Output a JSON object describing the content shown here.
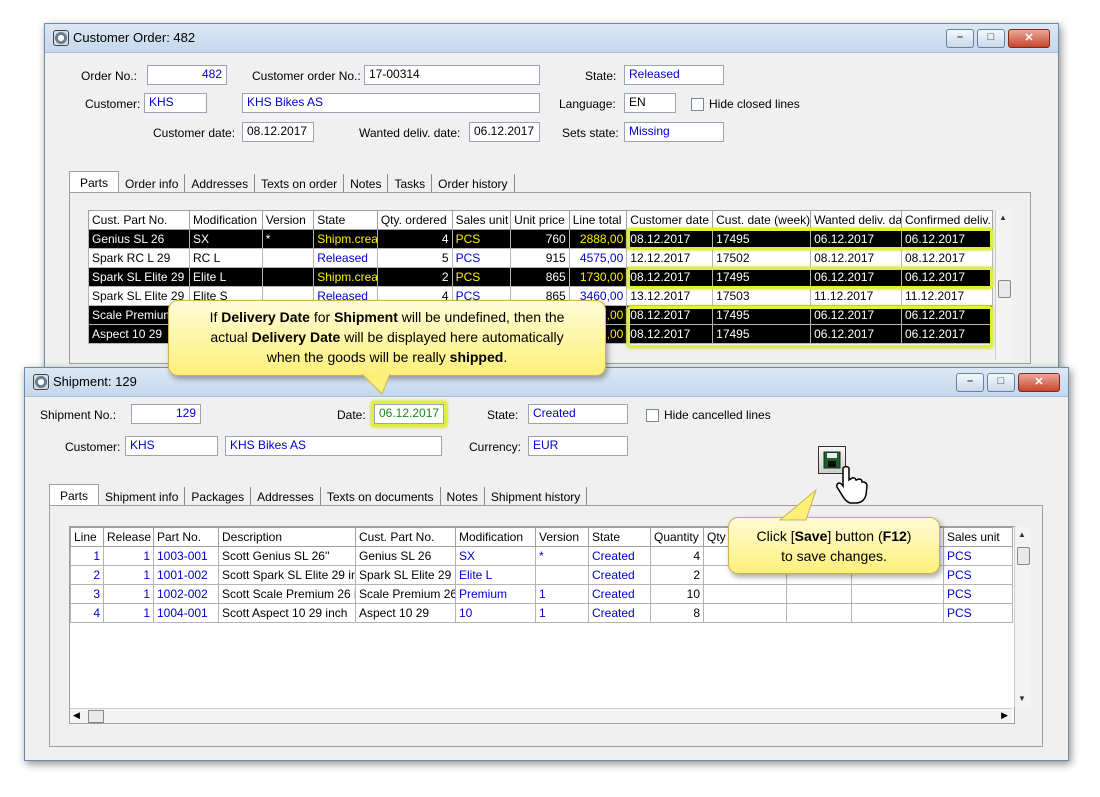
{
  "order_window": {
    "title": "Customer Order: 482",
    "order_no_label": "Order No.:",
    "order_no": "482",
    "customer_order_no_label": "Customer order No.:",
    "customer_order_no": "17-00314",
    "state_label": "State:",
    "state": "Released",
    "customer_label": "Customer:",
    "customer_code": "KHS",
    "customer_name": "KHS Bikes AS",
    "language_label": "Language:",
    "language": "EN",
    "hide_closed_label": "Hide closed lines",
    "customer_date_label": "Customer date:",
    "customer_date": "08.12.2017",
    "wanted_deliv_label": "Wanted deliv. date:",
    "wanted_deliv": "06.12.2017",
    "sets_state_label": "Sets state:",
    "sets_state": "Missing",
    "tabs": [
      "Parts",
      "Order info",
      "Addresses",
      "Texts on order",
      "Notes",
      "Tasks",
      "Order history"
    ],
    "columns": [
      "Cust. Part No.",
      "Modification",
      "Version",
      "State",
      "Qty. ordered",
      "Sales unit",
      "Unit price",
      "Line total",
      "Customer date",
      "Cust. date (week)",
      "Wanted deliv. da",
      "Confirmed deliv."
    ],
    "rows": [
      {
        "part": "Genius SL 26",
        "mod": "SX",
        "ver": "*",
        "state": "Shipm.creat",
        "qty": "4",
        "unit": "PCS",
        "price": "760",
        "total": "2888,00",
        "cdate": "08.12.2017",
        "cweek": "17495",
        "wanted": "06.12.2017",
        "confirmed": "06.12.2017"
      },
      {
        "part": "Spark RC L 29",
        "mod": "RC L",
        "ver": "",
        "state": "Released",
        "qty": "5",
        "unit": "PCS",
        "price": "915",
        "total": "4575,00",
        "cdate": "12.12.2017",
        "cweek": "17502",
        "wanted": "08.12.2017",
        "confirmed": "08.12.2017"
      },
      {
        "part": "Spark SL Elite 29",
        "mod": "Elite L",
        "ver": "",
        "state": "Shipm.creat",
        "qty": "2",
        "unit": "PCS",
        "price": "865",
        "total": "1730,00",
        "cdate": "08.12.2017",
        "cweek": "17495",
        "wanted": "06.12.2017",
        "confirmed": "06.12.2017"
      },
      {
        "part": "Spark SL Elite 29",
        "mod": "Elite S",
        "ver": "",
        "state": "Released",
        "qty": "4",
        "unit": "PCS",
        "price": "865",
        "total": "3460,00",
        "cdate": "13.12.2017",
        "cweek": "17503",
        "wanted": "11.12.2017",
        "confirmed": "11.12.2017"
      },
      {
        "part": "Scale Premium",
        "mod": "",
        "ver": "",
        "state": "",
        "qty": "",
        "unit": "",
        "price": "",
        "total": ",00",
        "cdate": "08.12.2017",
        "cweek": "17495",
        "wanted": "06.12.2017",
        "confirmed": "06.12.2017"
      },
      {
        "part": "Aspect 10 29",
        "mod": "",
        "ver": "",
        "state": "",
        "qty": "",
        "unit": "",
        "price": "",
        "total": ",00",
        "cdate": "08.12.2017",
        "cweek": "17495",
        "wanted": "06.12.2017",
        "confirmed": "06.12.2017"
      }
    ]
  },
  "shipment_window": {
    "title": "Shipment: 129",
    "shipment_no_label": "Shipment No.:",
    "shipment_no": "129",
    "date_label": "Date:",
    "date": "06.12.2017",
    "state_label": "State:",
    "state": "Created",
    "hide_cancelled_label": "Hide cancelled lines",
    "customer_label": "Customer:",
    "customer_code": "KHS",
    "customer_name": "KHS Bikes AS",
    "currency_label": "Currency:",
    "currency": "EUR",
    "tabs": [
      "Parts",
      "Shipment info",
      "Packages",
      "Addresses",
      "Texts on documents",
      "Notes",
      "Shipment history"
    ],
    "columns": [
      "Line",
      "Release",
      "Part No.",
      "Description",
      "Cust. Part No.",
      "Modification",
      "Version",
      "State",
      "Quantity",
      "Qty",
      "",
      "",
      "Sales unit"
    ],
    "rows": [
      {
        "line": "1",
        "release": "1",
        "partno": "1003-001",
        "desc": "Scott Genius SL 26''",
        "cust": "Genius SL 26",
        "mod": "SX",
        "ver": "*",
        "state": "Created",
        "qty": "4",
        "unit": "PCS"
      },
      {
        "line": "2",
        "release": "1",
        "partno": "1001-002",
        "desc": "Scott Spark SL Elite 29 in",
        "cust": "Spark SL Elite 29",
        "mod": "Elite L",
        "ver": "",
        "state": "Created",
        "qty": "2",
        "unit": "PCS"
      },
      {
        "line": "3",
        "release": "1",
        "partno": "1002-002",
        "desc": "Scott Scale Premium 26 ir",
        "cust": "Scale Premium 26",
        "mod": "Premium",
        "ver": "1",
        "state": "Created",
        "qty": "10",
        "unit": "PCS"
      },
      {
        "line": "4",
        "release": "1",
        "partno": "1004-001",
        "desc": "Scott Aspect 10 29 inch",
        "cust": "Aspect 10 29",
        "mod": "10",
        "ver": "1",
        "state": "Created",
        "qty": "8",
        "unit": "PCS"
      }
    ]
  },
  "callout_delivery": {
    "t1": "If ",
    "b1": "Delivery Date",
    "t2": " for ",
    "b2": "Shipment",
    "t3": " will be undefined, then the",
    "t4": "actual ",
    "b3": "Delivery Date",
    "t5": " will be displayed here automatically",
    "t6": "when the goods will be really ",
    "b4": "shipped",
    "t7": "."
  },
  "callout_save": {
    "t1": "Click [",
    "b1": "Save",
    "t2": "] button (",
    "b2": "F12",
    "t3": ")",
    "t4": "to save changes."
  },
  "colors": {
    "highlight": "#dfef3a",
    "callout": "#fdf07a",
    "field_text": "#0000d0"
  }
}
